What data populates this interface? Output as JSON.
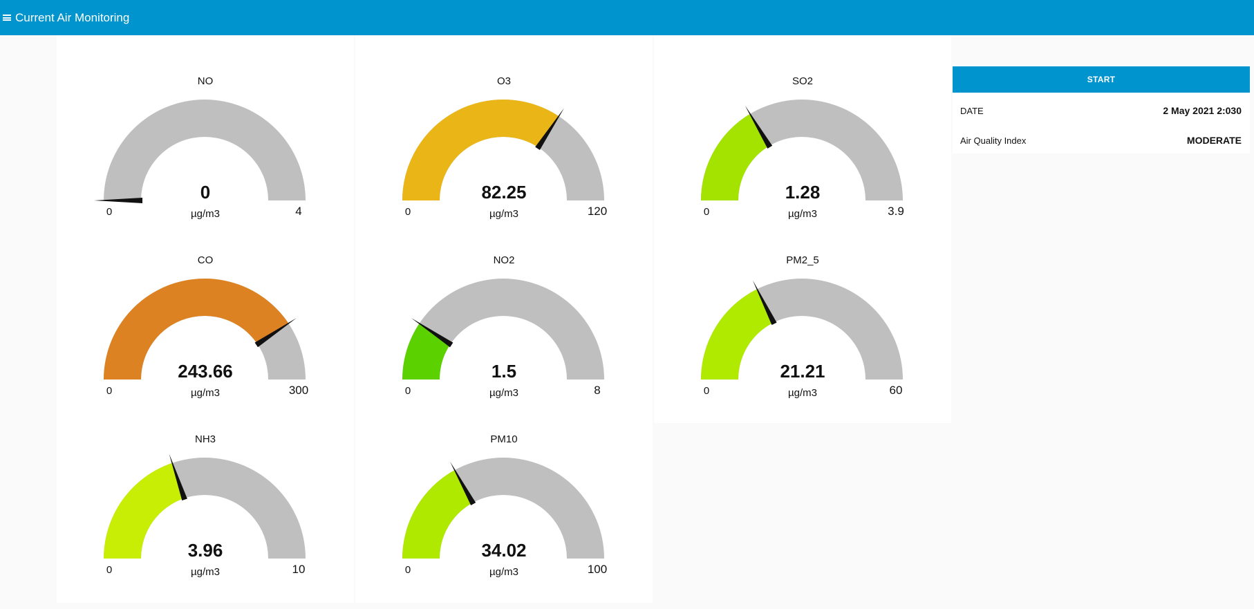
{
  "header": {
    "title": "Current Air Monitoring",
    "menu_icon": "hamburger-icon",
    "background": "#0094ce"
  },
  "gauges": [
    {
      "id": "no",
      "title": "NO",
      "value": 0,
      "display": "0",
      "min": "0",
      "max": "4",
      "minVal": 0,
      "maxVal": 4,
      "units": "µg/m3",
      "color": "#bfbfbf"
    },
    {
      "id": "co",
      "title": "CO",
      "value": 243.66,
      "display": "243.66",
      "min": "0",
      "max": "300",
      "minVal": 0,
      "maxVal": 300,
      "units": "µg/m3",
      "color": "#dd8223"
    },
    {
      "id": "nh3",
      "title": "NH3",
      "value": 3.96,
      "display": "3.96",
      "min": "0",
      "max": "10",
      "minVal": 0,
      "maxVal": 10,
      "units": "µg/m3",
      "color": "#c8ee06"
    },
    {
      "id": "o3",
      "title": "O3",
      "value": 82.25,
      "display": "82.25",
      "min": "0",
      "max": "120",
      "minVal": 0,
      "maxVal": 120,
      "units": "µg/m3",
      "color": "#eab516"
    },
    {
      "id": "no2",
      "title": "NO2",
      "value": 1.5,
      "display": "1.5",
      "min": "0",
      "max": "8",
      "minVal": 0,
      "maxVal": 8,
      "units": "µg/m3",
      "color": "#5bd100"
    },
    {
      "id": "pm10",
      "title": "PM10",
      "value": 34.02,
      "display": "34.02",
      "min": "0",
      "max": "100",
      "minVal": 0,
      "maxVal": 100,
      "units": "µg/m3",
      "color": "#b0e900"
    },
    {
      "id": "so2",
      "title": "SO2",
      "value": 1.28,
      "display": "1.28",
      "min": "0",
      "max": "3.9",
      "minVal": 0,
      "maxVal": 3.9,
      "units": "µg/m3",
      "color": "#a4e200"
    },
    {
      "id": "pm25",
      "title": "PM2_5",
      "value": 21.21,
      "display": "21.21",
      "min": "0",
      "max": "60",
      "minVal": 0,
      "maxVal": 60,
      "units": "µg/m3",
      "color": "#b0ea00"
    }
  ],
  "panel": {
    "start_label": "START",
    "date_label": "DATE",
    "date_value": "2 May 2021 2:030",
    "aqi_label": "Air Quality Index",
    "aqi_value": "MODERATE"
  },
  "colors": {
    "track": "#bfbfbf",
    "needle": "#111111",
    "accent": "#0094ce"
  }
}
